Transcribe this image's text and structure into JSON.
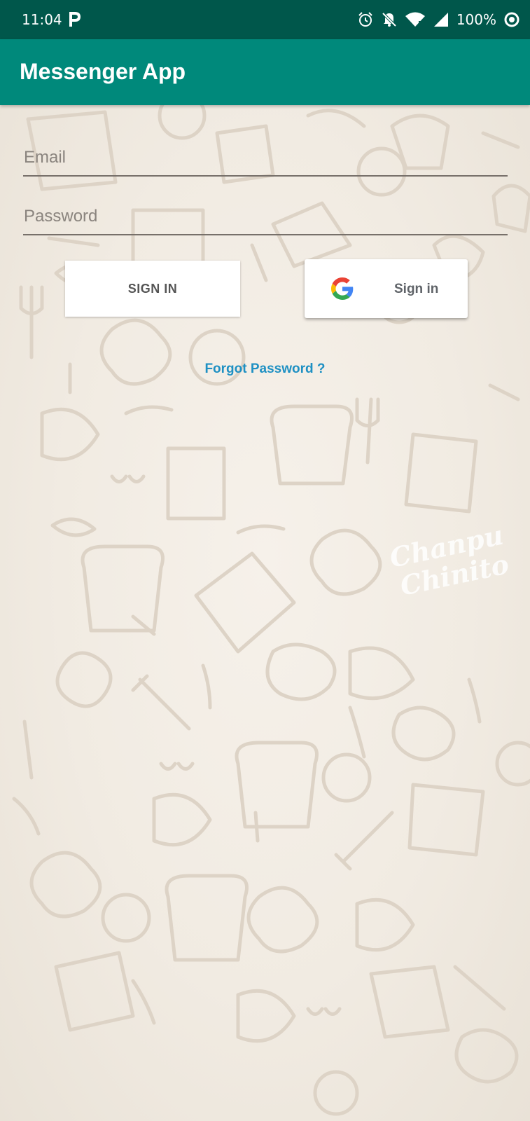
{
  "status_bar": {
    "time": "11:04",
    "battery": "100%"
  },
  "app_bar": {
    "title": "Messenger App"
  },
  "form": {
    "email_placeholder": "Email",
    "password_placeholder": "Password",
    "signin_label": "SIGN IN",
    "google_label": "Sign in",
    "forgot_label": "Forgot Password ?"
  },
  "icons": {
    "status_left": "parking-icon",
    "status_right": [
      "alarm-icon",
      "notifications-off-icon",
      "wifi-icon",
      "cell-signal-icon",
      "data-saver-icon"
    ],
    "google": "google-logo-icon"
  },
  "colors": {
    "status_bar": "#00574b",
    "app_bar": "#00897b",
    "link": "#1e90c3",
    "background": "#f3eee6"
  }
}
